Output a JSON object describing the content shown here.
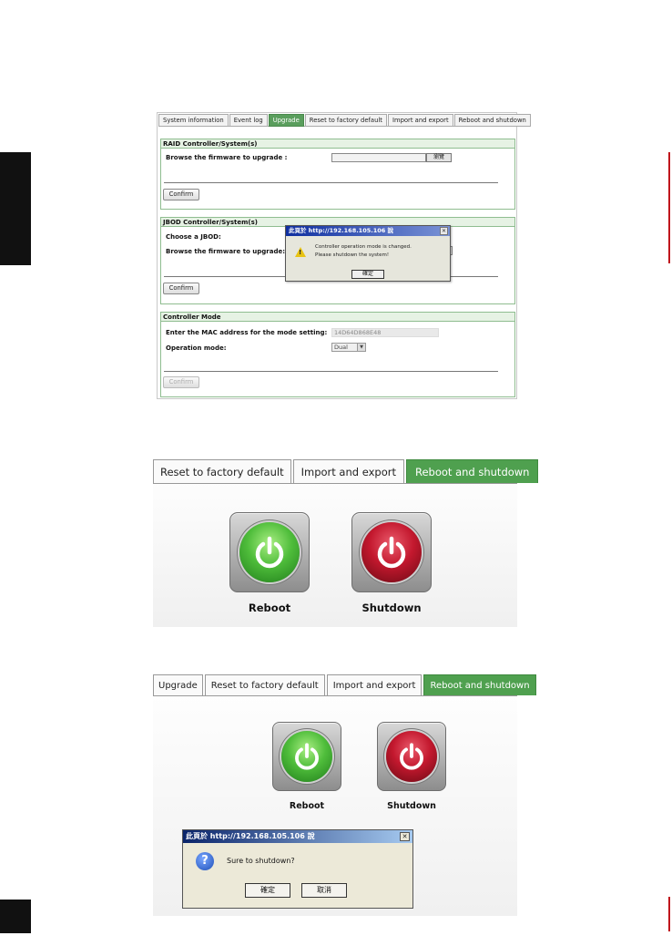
{
  "panel1": {
    "tabs": [
      "System information",
      "Event log",
      "Upgrade",
      "Reset to factory default",
      "Import and export",
      "Reboot and shutdown"
    ],
    "active_tab_index": 2,
    "raid": {
      "title": "RAID Controller/System(s)",
      "browse_label": "Browse the firmware to upgrade :",
      "browse_button": "瀏覽",
      "confirm": "Confirm"
    },
    "jbod": {
      "title": "JBOD Controller/System(s)",
      "choose_label": "Choose a JBOD:",
      "browse_label": "Browse the firmware to upgrade:",
      "confirm": "Confirm"
    },
    "controller_mode": {
      "title": "Controller Mode",
      "mac_label": "Enter the MAC address for the mode setting:",
      "mac_value": "14D64D868E48",
      "mode_label": "Operation mode:",
      "mode_value": "Dual",
      "confirm": "Confirm"
    },
    "dialog": {
      "title": "此頁於 http://192.168.105.106 說",
      "line1": "Controller operation mode is changed.",
      "line2": "Please shutdown the system!",
      "ok": "確定",
      "close": "✕"
    }
  },
  "panel2": {
    "tabs": [
      "Reset to factory default",
      "Import and export",
      "Reboot and shutdown"
    ],
    "active_tab_index": 2,
    "reboot_label": "Reboot",
    "shutdown_label": "Shutdown"
  },
  "panel3": {
    "tabs": [
      "Upgrade",
      "Reset to factory default",
      "Import and export",
      "Reboot and shutdown"
    ],
    "active_tab_index": 3,
    "reboot_label": "Reboot",
    "shutdown_label": "Shutdown",
    "dialog": {
      "title": "此頁於 http://192.168.105.106 說",
      "message": "Sure to shutdown?",
      "ok": "確定",
      "cancel": "取消",
      "close": "✕"
    }
  },
  "colors": {
    "active_tab": "#4fa04f",
    "section_border": "#8fbd90",
    "section_header": "#e6f2e4",
    "reboot_green": "#4fbd3b",
    "shutdown_red": "#c3182e"
  },
  "icons": [
    "power-icon",
    "warning-icon",
    "question-icon",
    "close-icon",
    "dropdown-arrow-icon"
  ]
}
